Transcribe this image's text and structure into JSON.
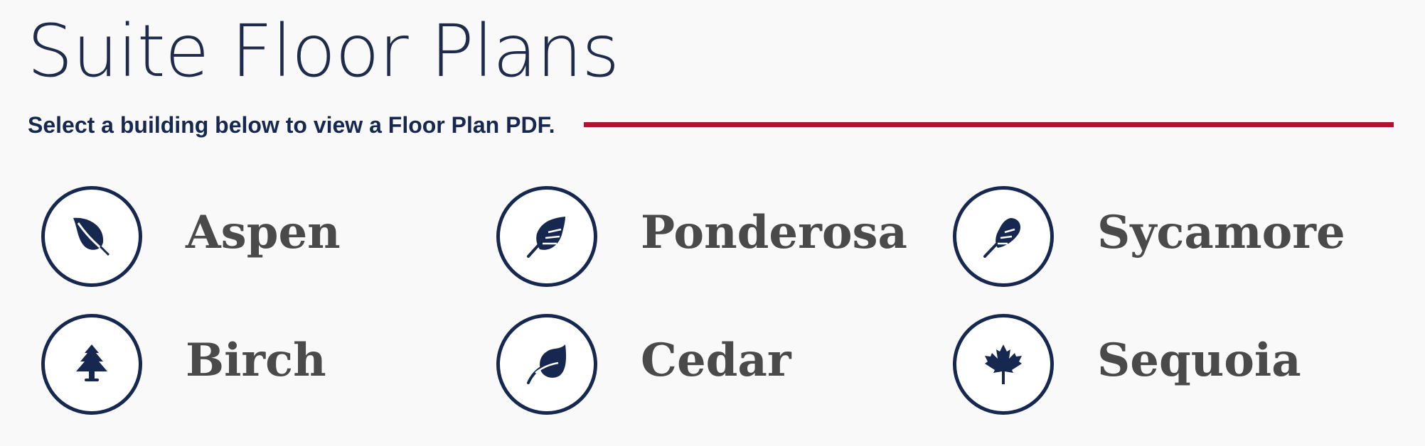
{
  "page": {
    "title": "Suite Floor Plans",
    "subtitle": "Select a building below to view a Floor Plan PDF."
  },
  "colors": {
    "title": "#1f2b4a",
    "subtitle": "#16284f",
    "accent_line": "#b0122f",
    "icon": "#16284f",
    "building_label": "#4a4a4a",
    "background": "#f9f9fa"
  },
  "buildings": [
    {
      "name": "Aspen",
      "icon": "leaf-icon"
    },
    {
      "name": "Ponderosa",
      "icon": "feather-icon"
    },
    {
      "name": "Sycamore",
      "icon": "feather-round-icon"
    },
    {
      "name": "Birch",
      "icon": "tree-icon"
    },
    {
      "name": "Cedar",
      "icon": "cedar-leaf-icon"
    },
    {
      "name": "Sequoia",
      "icon": "maple-leaf-icon"
    }
  ]
}
